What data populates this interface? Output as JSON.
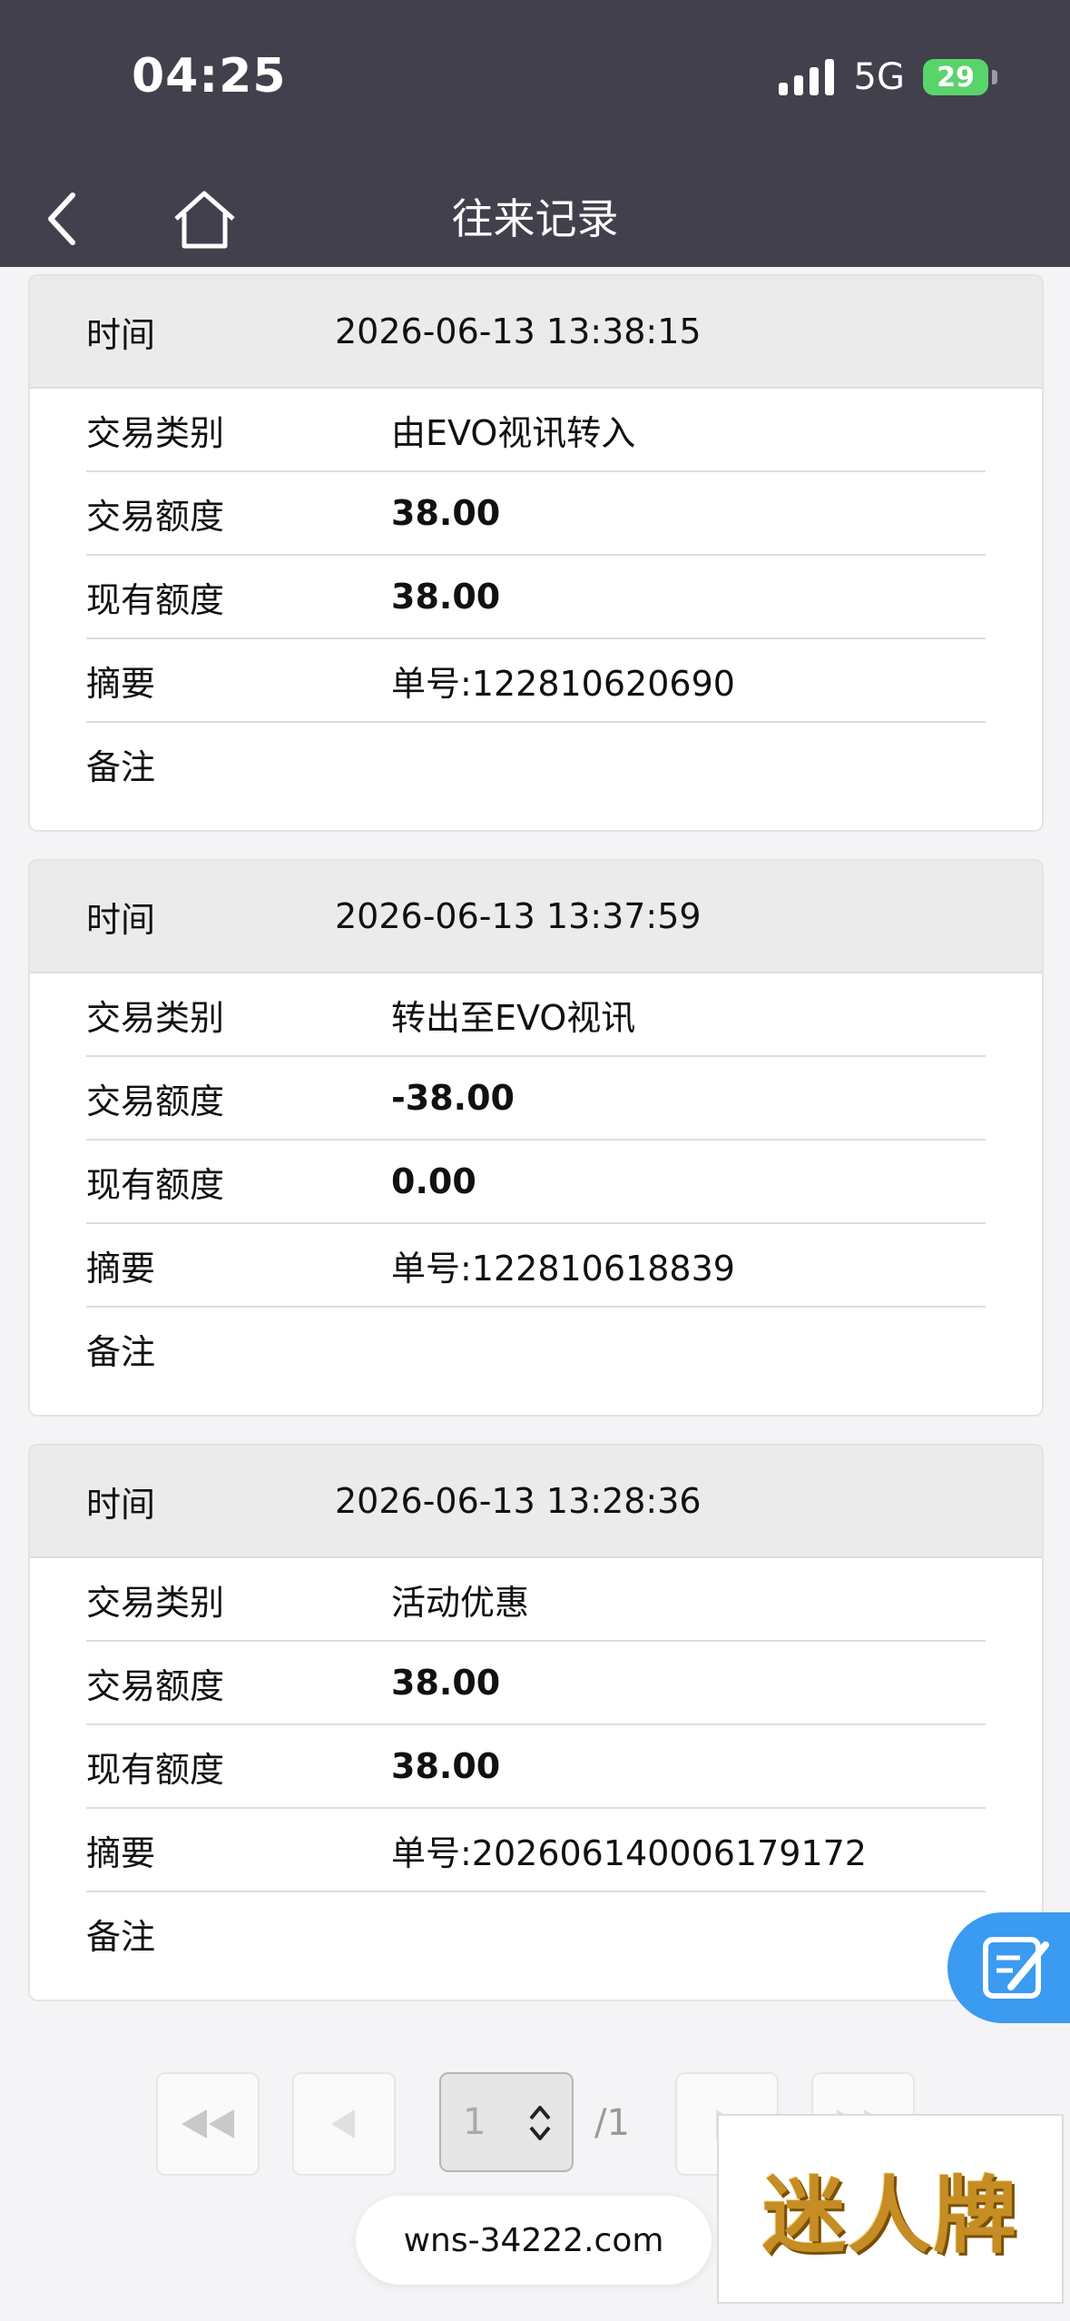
{
  "status_bar": {
    "time": "04:25",
    "network": "5G",
    "battery": "29"
  },
  "header": {
    "title": "往来记录"
  },
  "records": [
    {
      "time_label": "时间",
      "time": "2026-06-13 13:38:15",
      "type_label": "交易类别",
      "type": "由EVO视讯转入",
      "amount_label": "交易额度",
      "amount": "38.00",
      "balance_label": "现有额度",
      "balance": "38.00",
      "summary_label": "摘要",
      "summary": "单号:122810620690",
      "note_label": "备注",
      "note": ""
    },
    {
      "time_label": "时间",
      "time": "2026-06-13 13:37:59",
      "type_label": "交易类别",
      "type": "转出至EVO视讯",
      "amount_label": "交易额度",
      "amount": "-38.00",
      "balance_label": "现有额度",
      "balance": "0.00",
      "summary_label": "摘要",
      "summary": "单号:122810618839",
      "note_label": "备注",
      "note": ""
    },
    {
      "time_label": "时间",
      "time": "2026-06-13 13:28:36",
      "type_label": "交易类别",
      "type": "活动优惠",
      "amount_label": "交易额度",
      "amount": "38.00",
      "balance_label": "现有额度",
      "balance": "38.00",
      "summary_label": "摘要",
      "summary": "单号:202606140006179172",
      "note_label": "备注",
      "note": ""
    }
  ],
  "pagination": {
    "current_page": "1",
    "total_pages": "/1"
  },
  "footer": {
    "domain": "wns-34222.com",
    "logo_text": "迷人牌"
  },
  "icons": [
    "back-arrow-icon",
    "home-icon",
    "edit-note-icon",
    "first-page-icon",
    "prev-page-icon",
    "next-page-icon",
    "last-page-icon",
    "select-chevron-icon"
  ],
  "colors": {
    "header_bg": "#41404c",
    "fab_bg": "#3a9bf0",
    "battery_green": "#5bd36b",
    "logo_gold": "#c58d23"
  }
}
